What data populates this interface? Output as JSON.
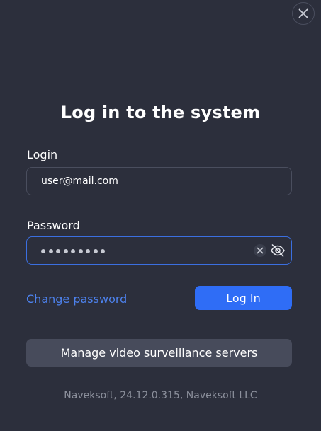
{
  "window": {
    "close_icon": "close-icon"
  },
  "title": "Log in to the system",
  "login": {
    "label": "Login",
    "value": "user@mail.com"
  },
  "password": {
    "label": "Password",
    "masked_length": 9,
    "clear_icon": "clear-icon",
    "visibility_icon": "eye-off-icon"
  },
  "actions": {
    "change_password": "Change password",
    "log_in": "Log In",
    "manage_servers": "Manage video surveillance servers"
  },
  "footer": "Naveksoft, 24.12.0.315, Naveksoft LLC",
  "colors": {
    "background": "#2c2f3c",
    "accent": "#2f6df6",
    "link": "#4d82ee",
    "focus_border": "#3b6fe0",
    "secondary_button": "#474b5b"
  }
}
